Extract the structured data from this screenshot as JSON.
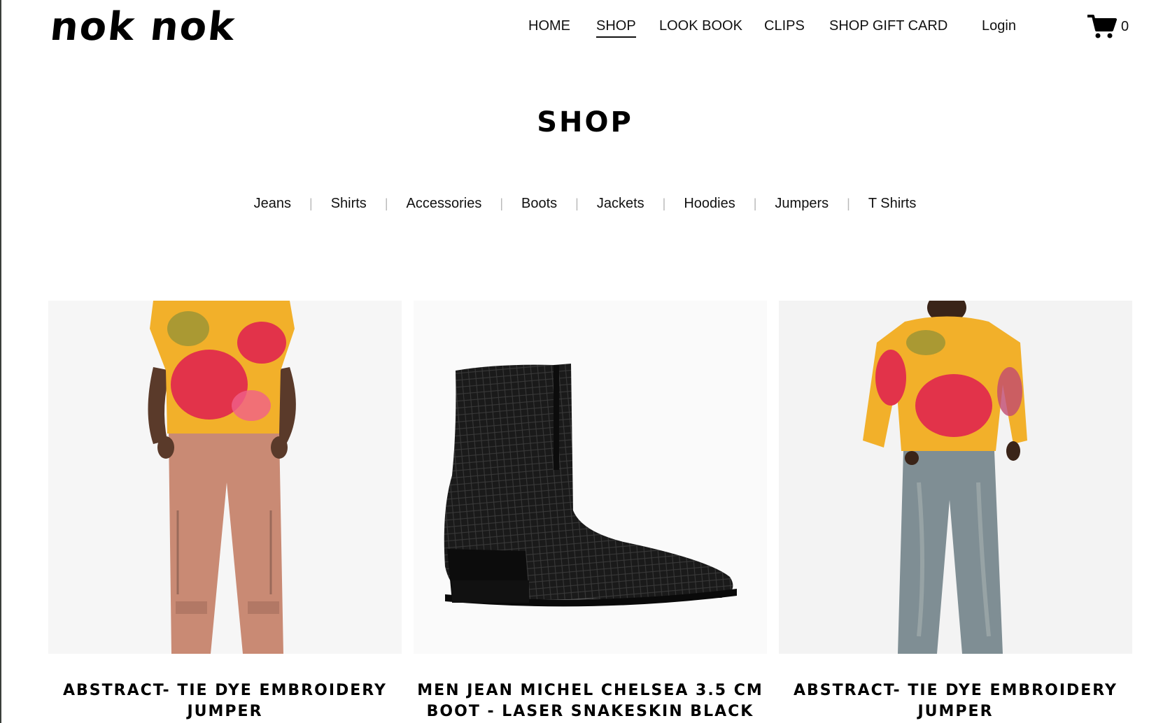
{
  "brand": {
    "logo_text": "nok nok"
  },
  "nav": {
    "items": [
      {
        "label": "HOME",
        "active": false
      },
      {
        "label": "SHOP",
        "active": true
      },
      {
        "label": "LOOK BOOK",
        "active": false
      },
      {
        "label": "CLIPS",
        "active": false
      },
      {
        "label": "SHOP GIFT CARD",
        "active": false
      }
    ],
    "login_label": "Login",
    "cart_count": "0",
    "cart_icon": "cart-icon"
  },
  "page": {
    "title": "SHOP"
  },
  "categories": [
    "Jeans",
    "Shirts",
    "Accessories",
    "Boots",
    "Jackets",
    "Hoodies",
    "Jumpers",
    "T Shirts"
  ],
  "products": [
    {
      "name": "ABSTRACT- TIE DYE EMBROIDERY JUMPER",
      "image": "model-in-tie-dye-sleeveless-top-and-pink-jeans"
    },
    {
      "name": "MEN JEAN MICHEL CHELSEA 3.5 CM BOOT - LASER SNAKESKIN BLACK",
      "image": "black-snakeskin-chelsea-boot"
    },
    {
      "name": "ABSTRACT- TIE DYE EMBROIDERY JUMPER",
      "image": "model-in-tie-dye-jumper-and-grey-jeans"
    }
  ],
  "colors": {
    "text": "#111111",
    "background": "#ffffff",
    "separator": "#b9b9b9",
    "tie_dye_red": "#e2334a",
    "tie_dye_yellow": "#f2b02a",
    "boot_black": "#161616"
  }
}
